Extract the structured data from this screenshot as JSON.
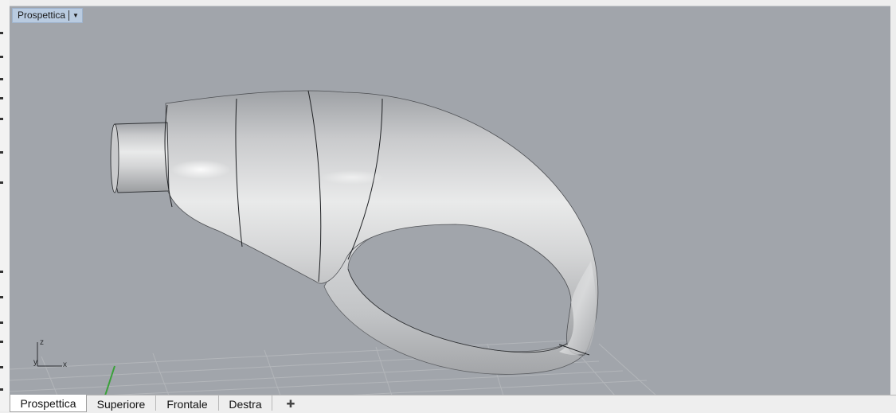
{
  "viewport": {
    "title": "Prospettica",
    "menu_icon": "chevron-down-icon",
    "background_color": "#a1a5ab",
    "axis": {
      "z_label": "z",
      "y_label": "y",
      "x_label": "x"
    }
  },
  "tabs": [
    {
      "label": "Prospettica",
      "active": true
    },
    {
      "label": "Superiore",
      "active": false
    },
    {
      "label": "Frontale",
      "active": false
    },
    {
      "label": "Destra",
      "active": false
    }
  ],
  "add_tab_icon": "plus-icon",
  "model": {
    "shape": "hook-shaped surface model",
    "color": "#d2d3d4"
  }
}
